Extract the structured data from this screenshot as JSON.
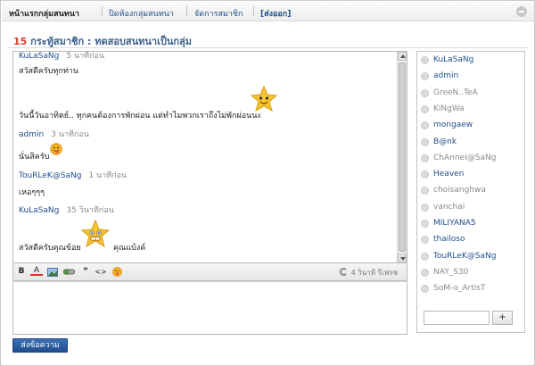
{
  "nav": {
    "items": [
      {
        "label": "หน้าแรกกลุ่มสนทนา",
        "active": true
      },
      {
        "label": "ปิดห้องกลุ่มสนทนา",
        "active": false
      },
      {
        "label": "จัดการสมาชิก",
        "active": false
      }
    ],
    "logout": "[ส่งออก]"
  },
  "room": {
    "member_count": "15",
    "title": "กระทู้สมาชิก : ทดสอบสนทนาเป็นกลุ่ม"
  },
  "chat": {
    "messages": [
      {
        "type": "header",
        "name": "KuLaSaNg",
        "time": "5 นาทีก่อน"
      },
      {
        "type": "text",
        "text": "สวัสดีครับทุกท่าน"
      },
      {
        "type": "text",
        "text": "วันนี้วันอาทิตย์.. ทุกคนต้องการพักผ่อน แต่ทำไมพวกเราถึงไม่พักผ่อนนะ"
      },
      {
        "type": "header",
        "name": "admin",
        "time": "3 นาทีก่อน"
      },
      {
        "type": "text",
        "text": "นั่นสิครับ"
      },
      {
        "type": "header",
        "name": "TouRLeK@SaNg",
        "time": "1 นาทีก่อน"
      },
      {
        "type": "text",
        "text": "เหอๆๆๆ"
      },
      {
        "type": "header",
        "name": "KuLaSaNg",
        "time": "35 วินาทีก่อน"
      },
      {
        "type": "text",
        "text": "สวัสดีครับคุณข้อย"
      },
      {
        "type": "text",
        "text": "คุณแบ้งค์"
      }
    ]
  },
  "toolbar": {
    "buttons": [
      {
        "icon": "bold-icon",
        "label": "B"
      },
      {
        "icon": "font-color-icon",
        "label": "A"
      },
      {
        "icon": "image-icon",
        "label": ""
      },
      {
        "icon": "link-icon",
        "label": ""
      },
      {
        "icon": "quote-icon",
        "label": "“"
      },
      {
        "icon": "code-icon",
        "label": "<>"
      },
      {
        "icon": "emoticon-icon",
        "label": ""
      }
    ],
    "status": "4 วินาที รีเฟรช"
  },
  "composer": {
    "value": ""
  },
  "send_label": "ส่งข้อความ",
  "members": [
    {
      "name": "KuLaSaNg",
      "online": true
    },
    {
      "name": "admin",
      "online": true
    },
    {
      "name": "GreeN..TeA",
      "online": false
    },
    {
      "name": "KiNgWa",
      "online": false
    },
    {
      "name": "mongaew",
      "online": true
    },
    {
      "name": "B@nk",
      "online": true
    },
    {
      "name": "ChAnneI@SaNg",
      "online": false
    },
    {
      "name": "Heaven",
      "online": true
    },
    {
      "name": "choisanghwa",
      "online": false
    },
    {
      "name": "vanchai",
      "online": false
    },
    {
      "name": "MILIYANA5",
      "online": true
    },
    {
      "name": "thailoso",
      "online": true
    },
    {
      "name": "TouRLeK@SaNg",
      "online": true
    },
    {
      "name": "NAY_S30",
      "online": false
    },
    {
      "name": "SoM-o_ArtisT",
      "online": false
    }
  ],
  "invite": {
    "value": "",
    "button_label": "+"
  },
  "colors": {
    "link": "#1f4f8a",
    "count": "#d8402a",
    "button": "#2a5a9b"
  }
}
